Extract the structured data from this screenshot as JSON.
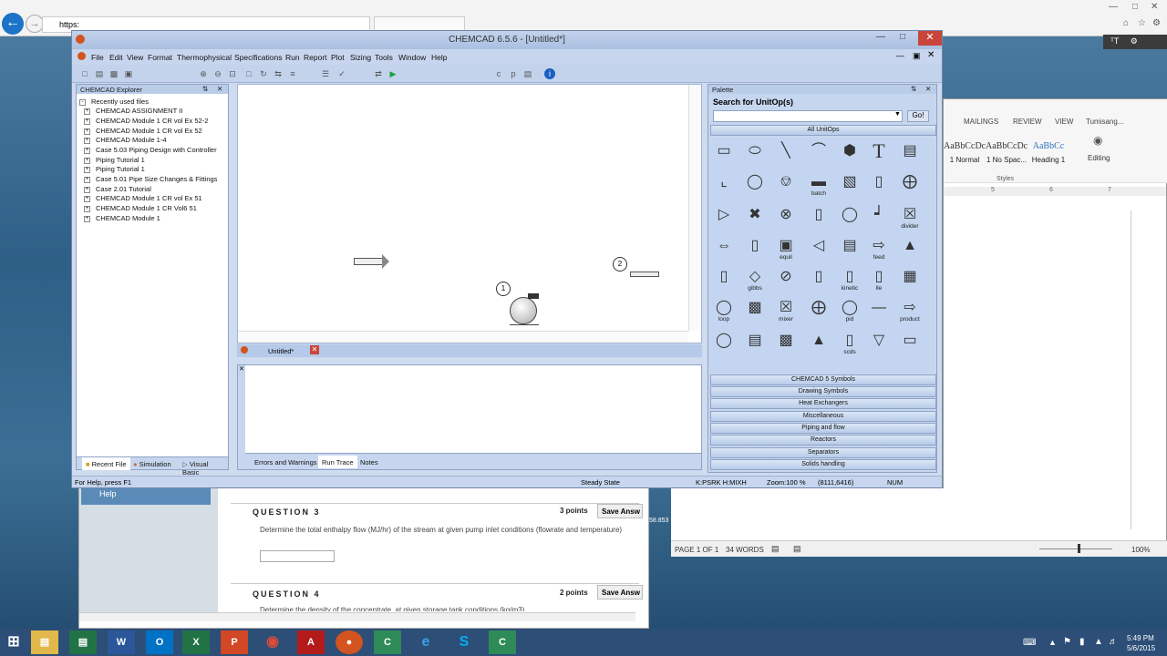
{
  "browser": {
    "address": "https:",
    "tab": ""
  },
  "word": {
    "tabs": [
      "MAILINGS",
      "REVIEW",
      "VIEW",
      "Tumisang..."
    ],
    "styles": [
      {
        "sample": "AaBbCcDc",
        "name": "1 Normal"
      },
      {
        "sample": "AaBbCcDc",
        "name": "1 No Spac..."
      },
      {
        "sample": "AaBbCc",
        "name": "Heading 1"
      }
    ],
    "styles_group": "Styles",
    "editing": "Editing",
    "status": {
      "page": "PAGE 1 OF 1",
      "words": "34 WORDS",
      "zoom": "100%"
    },
    "ruler": [
      "5",
      "6",
      "7"
    ]
  },
  "quiz": {
    "help": "Help",
    "q3": {
      "title": "QUESTION 3",
      "points": "3 points",
      "save": "Save Answ",
      "text": "Determine the total enthalpy flow (MJ/hr) of the stream at given pump inlet conditions (flowrate and temperature)"
    },
    "q4": {
      "title": "QUESTION 4",
      "points": "2 points",
      "save": "Save Answ",
      "text": "Determine the density of the concentrate, at given storage tank conditions (kg/m3)"
    },
    "side_value": "58.853"
  },
  "chemcad": {
    "title": "CHEMCAD 6.5.6 - [Untitled*]",
    "menu": [
      "File",
      "Edit",
      "View",
      "Format",
      "Thermophysical",
      "Specifications",
      "Run",
      "Report",
      "Plot",
      "Sizing",
      "Tools",
      "Window",
      "Help"
    ],
    "explorer": {
      "title": "CHEMCAD Explorer",
      "root": "Recently used files",
      "items": [
        "CHEMCAD ASSIGNMENT II",
        "CHEMCAD Module 1 CR vol Ex 52-2",
        "CHEMCAD Module 1 CR vol Ex 52",
        "CHEMCAD Module 1-4",
        "Case 5.03 Piping Design with Controller",
        "Piping Tutorial 1",
        "Piping Tutorial 1",
        "Case 5.01 Pipe Size Changes & Fittings",
        "Case 2.01 Tutorial",
        "CHEMCAD Module 1 CR vol Ex 51",
        "CHEMCAD Module 1 CR Vol6 51",
        "CHEMCAD Module 1"
      ],
      "tabs": [
        "Recent File",
        "Simulation",
        "Visual Basic"
      ]
    },
    "flowsheet": {
      "stream1": "1",
      "stream2": "2"
    },
    "doc_tab": "Untitled*",
    "output_tabs": [
      "Errors and Warnings",
      "Run Trace",
      "Notes"
    ],
    "palette": {
      "title": "Palette",
      "search_label": "Search for UnitOp(s)",
      "go": "Go!",
      "all": "All UnitOps",
      "labels": [
        "batch",
        "divider",
        "equil",
        "feed",
        "gibbs",
        "kinetic",
        "lle",
        "loop",
        "mixer",
        "pid",
        "product",
        "scds"
      ],
      "categories": [
        "CHEMCAD 5 Symbols",
        "Drawing Symbols",
        "Heat Exchangers",
        "Miscellaneous",
        "Piping and flow",
        "Reactors",
        "Separators",
        "Solids handling"
      ]
    },
    "status": {
      "help": "For Help, press F1",
      "mode": "Steady State",
      "thermo": "K:PSRK H:MIXH",
      "zoom": "Zoom:100 %",
      "coords": "(8111,6416)",
      "num": "NUM"
    }
  },
  "taskbar": {
    "time": "5:49 PM",
    "date": "5/6/2015"
  }
}
